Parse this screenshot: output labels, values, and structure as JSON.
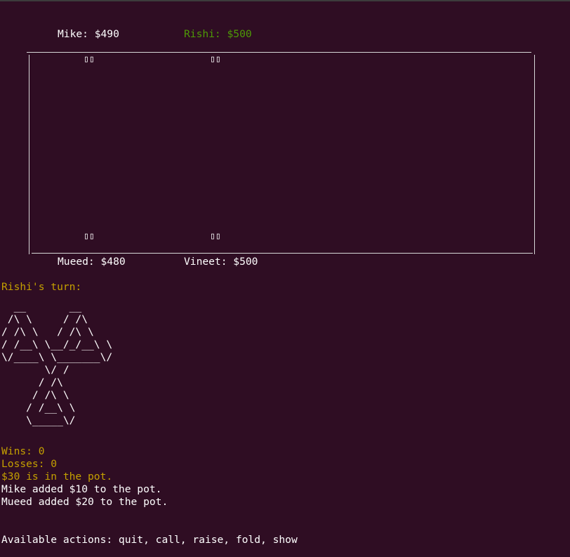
{
  "players": {
    "mike": "Mike: $490",
    "rishi": "Rishi: $500",
    "mueed": "Mueed: $480",
    "vineet": "Vineet: $500"
  },
  "cards": {
    "mike_cards": "▯▯",
    "rishi_cards": "▯▯",
    "mueed_cards": "▯▯",
    "vineet_cards": "▯▯"
  },
  "turn": "Rishi's turn:",
  "ascii_art": "  __       __\n /\\ \\     / /\\\n/ /\\ \\   / /\\ \\\n/ /__\\ \\__/_/__\\ \\\n\\/____\\ \\_______\\/\n       \\/ /\n      / /\\\n     / /\\ \\\n    / /__\\ \\\n    \\_____\\/",
  "stats": {
    "wins": "Wins: 0",
    "losses": "Losses: 0",
    "pot": "$30 is in the pot."
  },
  "log": [
    "Mike added $10 to the pot.",
    "Mueed added $20 to the pot."
  ],
  "actions": "Available actions: quit, call, raise, fold, show",
  "colors": {
    "background": "#2f0d23",
    "yellow": "#c4a000",
    "green": "#4e9a06"
  }
}
